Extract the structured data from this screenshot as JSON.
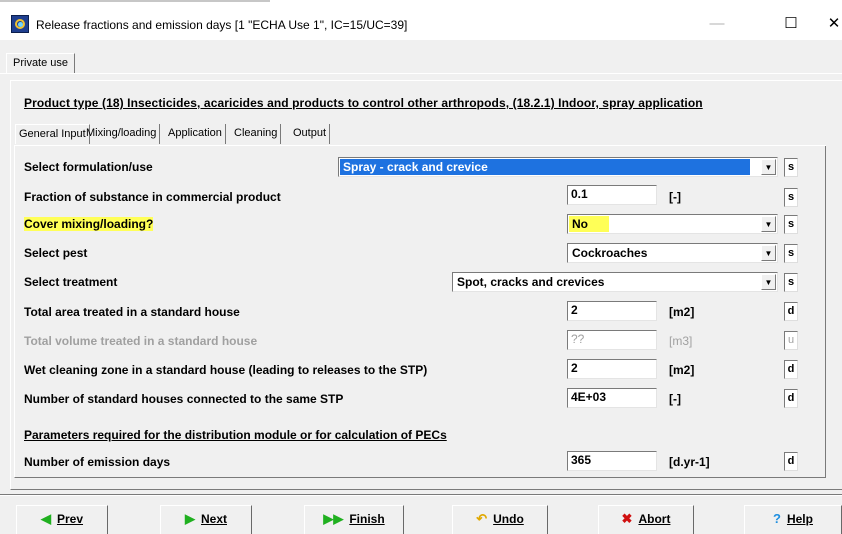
{
  "window": {
    "title": "Release fractions and emission days [1 \"ECHA Use 1\", IC=15/UC=39]",
    "min_glyph": "—",
    "max_glyph": "☐",
    "close_glyph": "✕",
    "icon": "app-globe-icon"
  },
  "top_tab": {
    "label": "Private use"
  },
  "product_type": "Product type (18) Insecticides, acaricides and products to control other arthropods, (18.2.1) Indoor, spray application",
  "tabs": [
    {
      "label": "General Input",
      "active": true
    },
    {
      "label": "Mixing/loading",
      "active": false
    },
    {
      "label": "Application",
      "active": false
    },
    {
      "label": "Cleaning",
      "active": false
    },
    {
      "label": "Output",
      "active": false
    }
  ],
  "form": {
    "formulation": {
      "label": "Select formulation/use",
      "value": "Spray - crack and crevice",
      "flag": "s"
    },
    "fraction": {
      "label": "Fraction of substance in commercial product",
      "value": "0.1",
      "unit": "[-]",
      "flag": "s"
    },
    "cover_mixing": {
      "label": "Cover mixing/loading?",
      "value": "No",
      "flag": "s",
      "highlight_color": "#ffff57"
    },
    "pest": {
      "label": "Select pest",
      "value": "Cockroaches",
      "flag": "s"
    },
    "treatment": {
      "label": "Select treatment",
      "value": "Spot, cracks and crevices",
      "flag": "s"
    },
    "total_area": {
      "label": "Total area treated in a standard house",
      "value": "2",
      "unit": "[m2]",
      "flag": "d"
    },
    "total_volume": {
      "label": "Total volume treated in a standard house",
      "value": "??",
      "unit": "[m3]",
      "flag": "u"
    },
    "wet_cleaning": {
      "label": "Wet cleaning zone in a standard house (leading to releases to the STP)",
      "value": "2",
      "unit": "[m2]",
      "flag": "d"
    },
    "num_houses": {
      "label": "Number of standard houses connected to the same STP",
      "value": "4E+03",
      "unit": "[-]",
      "flag": "d"
    },
    "section_heading": "Parameters required for the distribution module or for calculation of PECs",
    "emission_days": {
      "label": "Number of emission days",
      "value": "365",
      "unit": "[d.yr-1]",
      "flag": "d"
    }
  },
  "buttons": {
    "prev": "Prev",
    "next": "Next",
    "finish": "Finish",
    "undo": "Undo",
    "abort": "Abort",
    "help": "Help"
  },
  "colors": {
    "selection_blue": "#1e72e0",
    "highlight_yellow": "#ffff57",
    "window_bg": "#f0f0f0"
  }
}
